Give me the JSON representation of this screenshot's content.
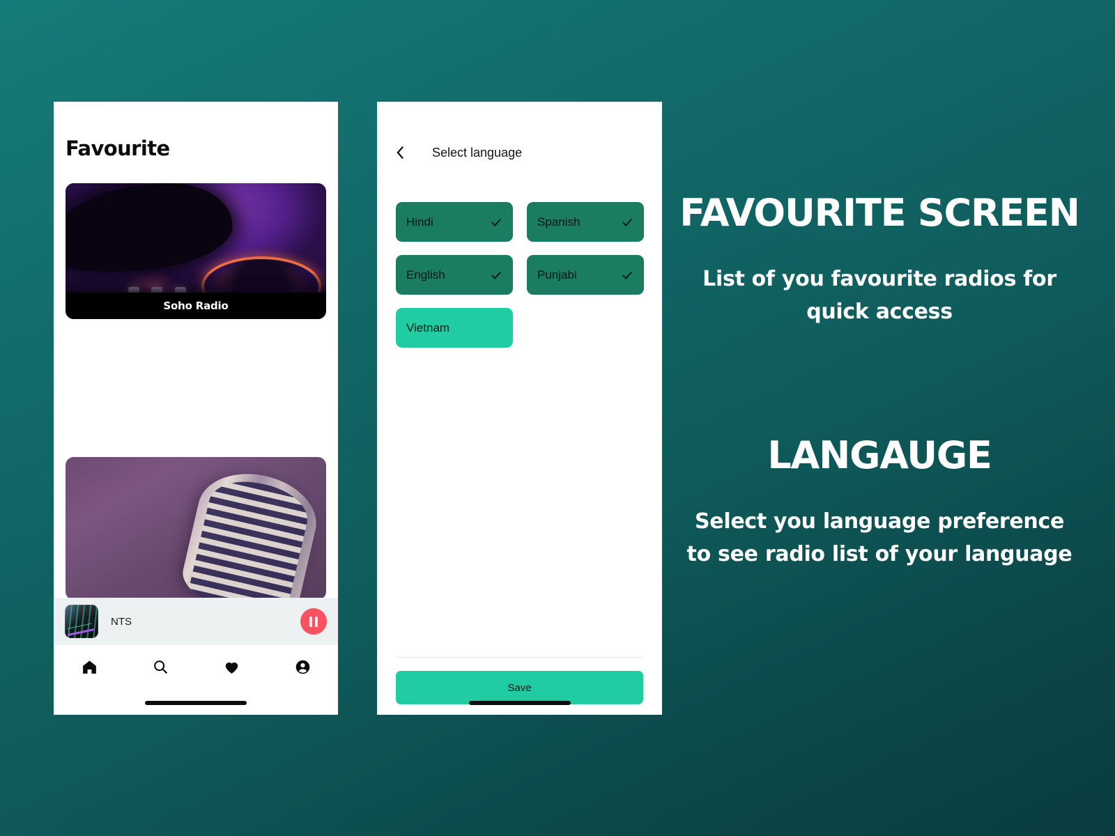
{
  "theme": {
    "background_gradient_from": "#167b78",
    "background_gradient_to": "#0a3c3f",
    "chip_selected": "#1a7d62",
    "chip_unselected": "#22cca3",
    "save_button": "#22cca3",
    "pause_button": "#f8515f"
  },
  "favourite_screen": {
    "title": "Favourite",
    "cards": [
      {
        "name": "Soho Radio",
        "artwork": "dj-deck-purple"
      },
      {
        "name": "",
        "artwork": "vintage-microphone-mauve"
      }
    ],
    "mini_player": {
      "station": "NTS",
      "thumbnail": "mixing-console-thumbnail",
      "control_icon": "pause-icon"
    },
    "bottom_nav": [
      {
        "icon": "home-icon",
        "name": "home"
      },
      {
        "icon": "search-icon",
        "name": "search"
      },
      {
        "icon": "heart-icon",
        "name": "favourites"
      },
      {
        "icon": "account-icon",
        "name": "profile"
      }
    ]
  },
  "language_screen": {
    "back_icon": "chevron-left-icon",
    "title": "Select language",
    "chips": [
      {
        "label": "Hindi",
        "selected": true
      },
      {
        "label": "Spanish",
        "selected": true
      },
      {
        "label": "English",
        "selected": true
      },
      {
        "label": "Punjabi",
        "selected": true
      },
      {
        "label": "Vietnam",
        "selected": false
      }
    ],
    "save_label": "Save"
  },
  "annotations": {
    "favourite": {
      "heading": "FAVOURITE SCREEN",
      "body": "List of you favourite radios for quick access"
    },
    "language": {
      "heading": "LANGAUGE",
      "body": "Select you language preference to see radio list of your language"
    }
  }
}
